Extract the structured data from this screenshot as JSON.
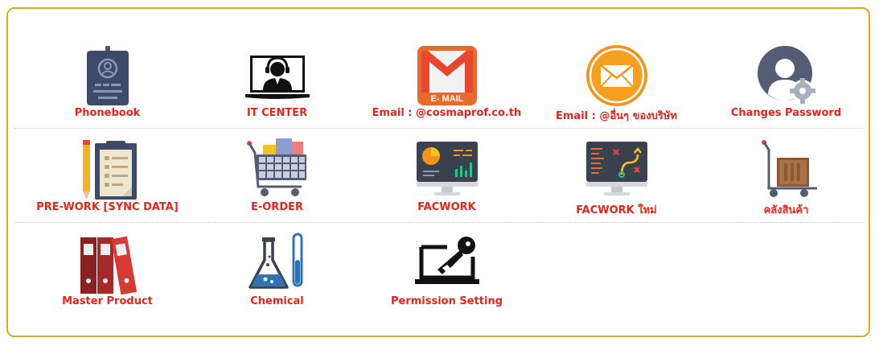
{
  "menu": {
    "phonebook": {
      "label": "Phonebook",
      "icon": "id-badge-icon"
    },
    "it_center": {
      "label": "IT CENTER",
      "icon": "support-agent-icon"
    },
    "email_cosmaprof": {
      "label": "Email : @cosmaprof.co.th",
      "icon": "gmail-icon",
      "icon_text": "E- MAIL"
    },
    "email_other": {
      "label": "Email : @อื่นๆ ของบริษัท",
      "icon": "envelope-icon"
    },
    "change_password": {
      "label": "Changes Password",
      "icon": "user-settings-icon"
    },
    "pre_work": {
      "label": "PRE-WORK [SYNC DATA]",
      "icon": "clipboard-icon"
    },
    "e_order": {
      "label": "E-ORDER",
      "icon": "shopping-cart-icon"
    },
    "facwork": {
      "label": "FACWORK",
      "icon": "dashboard-monitor-icon"
    },
    "facwork_new": {
      "label": "FACWORK ใหม่",
      "icon": "strategy-monitor-icon"
    },
    "warehouse": {
      "label": "คลังสินค้า",
      "icon": "hand-truck-icon"
    },
    "master_product": {
      "label": "Master Product",
      "icon": "binders-icon"
    },
    "chemical": {
      "label": "Chemical",
      "icon": "lab-flask-icon"
    },
    "permission_setting": {
      "label": "Permission Setting",
      "icon": "laptop-key-icon"
    }
  },
  "colors": {
    "border": "#e0a81e",
    "label": "#e8231a"
  }
}
